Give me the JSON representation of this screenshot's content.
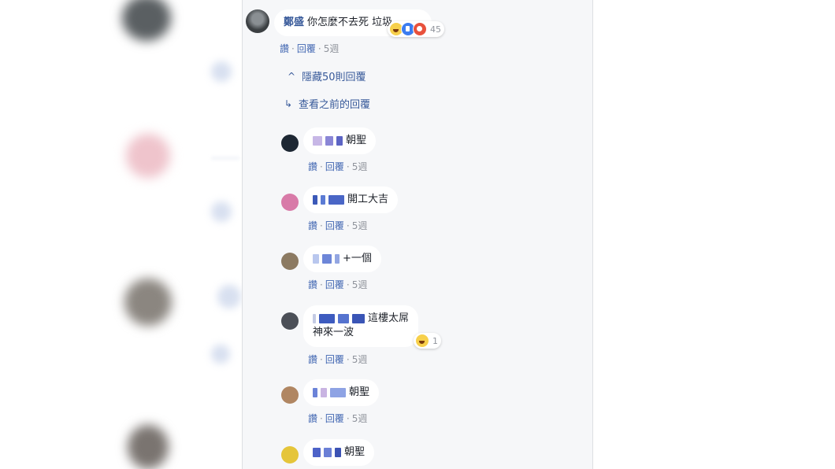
{
  "comments": [
    {
      "author": "鄭盛",
      "text": "你怎麼不去死 垃圾",
      "actions": {
        "like": "讚",
        "reply": "回覆",
        "time": "5週"
      },
      "reactions": {
        "icons": [
          "haha-icon",
          "like-icon",
          "angry-icon"
        ],
        "count": "45"
      }
    }
  ],
  "thread": {
    "hide_replies": "隱藏50則回覆",
    "view_previous": "查看之前的回覆"
  },
  "replies": [
    {
      "text": "朝聖",
      "actions": {
        "like": "讚",
        "reply": "回覆",
        "time": "5週"
      }
    },
    {
      "text": "開工大吉",
      "actions": {
        "like": "讚",
        "reply": "回覆",
        "time": "5週"
      }
    },
    {
      "text": "+一個",
      "actions": {
        "like": "讚",
        "reply": "回覆",
        "time": "5週"
      }
    },
    {
      "text": "這樓太屌",
      "text2": "神來一波",
      "actions": {
        "like": "讚",
        "reply": "回覆",
        "time": "5週"
      },
      "reactions": {
        "icons": [
          "haha-icon"
        ],
        "count": "1"
      }
    },
    {
      "text": "朝聖",
      "actions": {
        "like": "讚",
        "reply": "回覆",
        "time": "5週"
      }
    },
    {
      "text": "朝聖"
    }
  ],
  "colors": {
    "link": "#365899",
    "action": "#4267b2",
    "meta": "#90949c",
    "panel_bg": "#f6f7f9"
  }
}
